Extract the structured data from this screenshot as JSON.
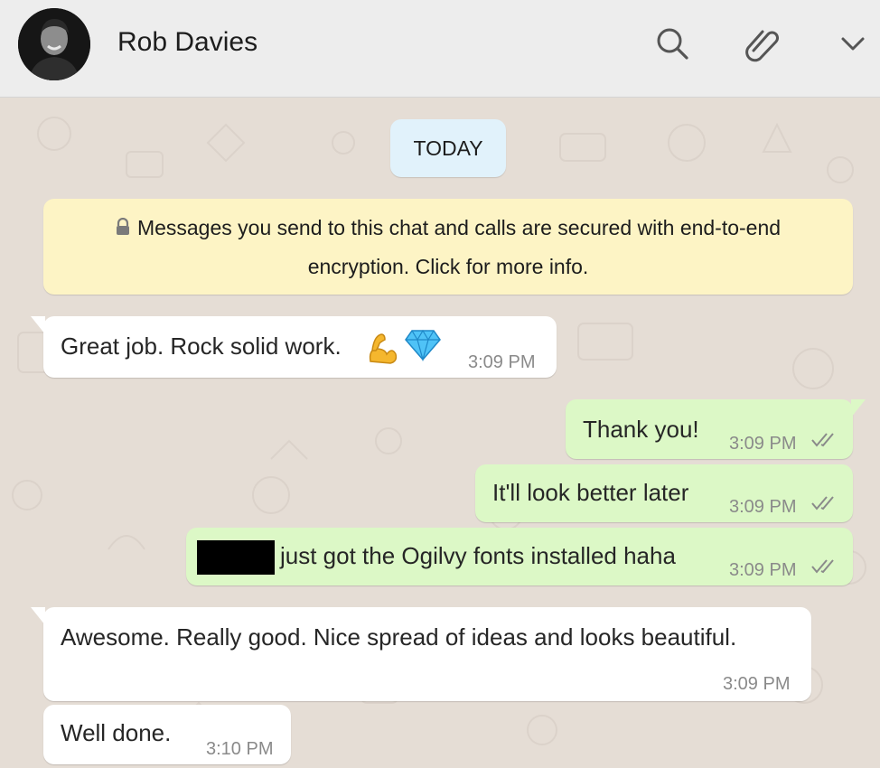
{
  "header": {
    "contact_name": "Rob Davies",
    "avatar_icon": "contact-avatar",
    "icons": [
      "search-icon",
      "paperclip-icon",
      "chevron-down-icon"
    ]
  },
  "chat": {
    "date_label": "TODAY",
    "encryption_notice": "Messages you send to this chat and calls are secured with end-to-end encryption. Click for more info.",
    "messages": [
      {
        "direction": "in",
        "text": "Great job. Rock solid work.",
        "emojis": [
          "flexed-biceps",
          "gem"
        ],
        "time": "3:09 PM"
      },
      {
        "direction": "out",
        "text": "Thank you!",
        "time": "3:09 PM",
        "status": "read-ticks"
      },
      {
        "direction": "out",
        "text": "It'll look better later",
        "time": "3:09 PM",
        "status": "read-ticks"
      },
      {
        "direction": "out",
        "text": "just got the Ogilvy fonts installed haha",
        "time": "3:09 PM",
        "status": "read-ticks",
        "redacted_prefix": true
      },
      {
        "direction": "in",
        "text": "Awesome. Really good. Nice spread of ideas and looks beautiful.",
        "time": "3:09 PM"
      },
      {
        "direction": "in",
        "text": "Well done.",
        "time": "3:10 PM"
      }
    ]
  },
  "colors": {
    "header_bg": "#ededed",
    "chat_bg": "#e5ddd5",
    "incoming_bubble": "#ffffff",
    "outgoing_bubble": "#dcf8c6",
    "date_chip": "#e1f2fb",
    "notice_bg": "#fdf4c5",
    "tick_color": "#8a8a8a"
  }
}
